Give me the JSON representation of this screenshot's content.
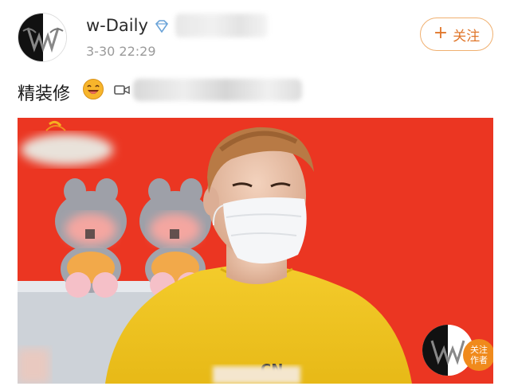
{
  "post": {
    "username": "w-Daily",
    "timestamp": "3-30 22:29",
    "text": "精装修",
    "follow_label": "关注",
    "follow_plus": "+",
    "avatar_letter": "W",
    "source_blurred": true,
    "link_blurred": true
  },
  "image": {
    "tag_letter": "CN",
    "watermark_letter": "W",
    "watermark_badge": "关注\n作者"
  },
  "colors": {
    "background_red": "#e8311e",
    "follow_orange": "#e0762a",
    "follow_border": "#f0b070",
    "shirt_yellow": "#f2c623",
    "badge_orange": "#f08a1c"
  }
}
